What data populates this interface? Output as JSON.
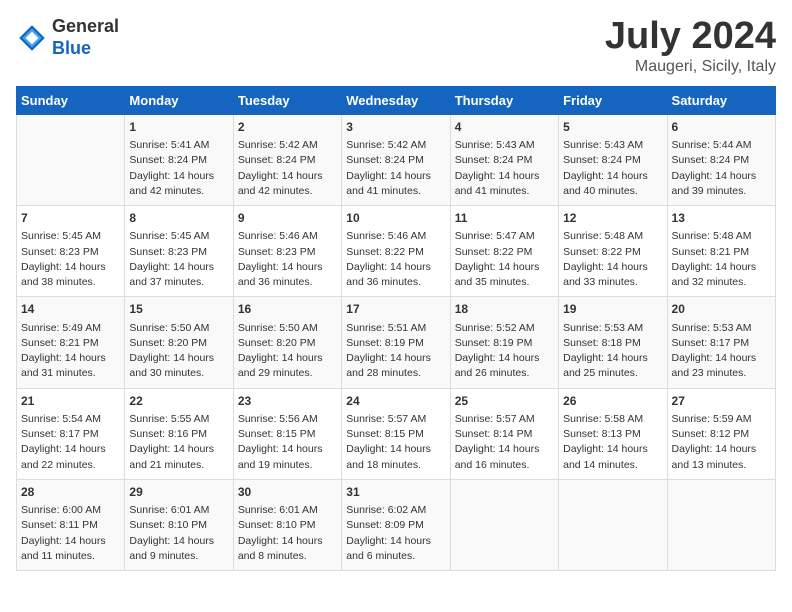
{
  "header": {
    "logo_general": "General",
    "logo_blue": "Blue",
    "month": "July 2024",
    "location": "Maugeri, Sicily, Italy"
  },
  "weekdays": [
    "Sunday",
    "Monday",
    "Tuesday",
    "Wednesday",
    "Thursday",
    "Friday",
    "Saturday"
  ],
  "weeks": [
    [
      {
        "day": "",
        "sunrise": "",
        "sunset": "",
        "daylight": "",
        "empty": true
      },
      {
        "day": "1",
        "sunrise": "Sunrise: 5:41 AM",
        "sunset": "Sunset: 8:24 PM",
        "daylight": "Daylight: 14 hours and 42 minutes."
      },
      {
        "day": "2",
        "sunrise": "Sunrise: 5:42 AM",
        "sunset": "Sunset: 8:24 PM",
        "daylight": "Daylight: 14 hours and 42 minutes."
      },
      {
        "day": "3",
        "sunrise": "Sunrise: 5:42 AM",
        "sunset": "Sunset: 8:24 PM",
        "daylight": "Daylight: 14 hours and 41 minutes."
      },
      {
        "day": "4",
        "sunrise": "Sunrise: 5:43 AM",
        "sunset": "Sunset: 8:24 PM",
        "daylight": "Daylight: 14 hours and 41 minutes."
      },
      {
        "day": "5",
        "sunrise": "Sunrise: 5:43 AM",
        "sunset": "Sunset: 8:24 PM",
        "daylight": "Daylight: 14 hours and 40 minutes."
      },
      {
        "day": "6",
        "sunrise": "Sunrise: 5:44 AM",
        "sunset": "Sunset: 8:24 PM",
        "daylight": "Daylight: 14 hours and 39 minutes."
      }
    ],
    [
      {
        "day": "7",
        "sunrise": "Sunrise: 5:45 AM",
        "sunset": "Sunset: 8:23 PM",
        "daylight": "Daylight: 14 hours and 38 minutes."
      },
      {
        "day": "8",
        "sunrise": "Sunrise: 5:45 AM",
        "sunset": "Sunset: 8:23 PM",
        "daylight": "Daylight: 14 hours and 37 minutes."
      },
      {
        "day": "9",
        "sunrise": "Sunrise: 5:46 AM",
        "sunset": "Sunset: 8:23 PM",
        "daylight": "Daylight: 14 hours and 36 minutes."
      },
      {
        "day": "10",
        "sunrise": "Sunrise: 5:46 AM",
        "sunset": "Sunset: 8:22 PM",
        "daylight": "Daylight: 14 hours and 36 minutes."
      },
      {
        "day": "11",
        "sunrise": "Sunrise: 5:47 AM",
        "sunset": "Sunset: 8:22 PM",
        "daylight": "Daylight: 14 hours and 35 minutes."
      },
      {
        "day": "12",
        "sunrise": "Sunrise: 5:48 AM",
        "sunset": "Sunset: 8:22 PM",
        "daylight": "Daylight: 14 hours and 33 minutes."
      },
      {
        "day": "13",
        "sunrise": "Sunrise: 5:48 AM",
        "sunset": "Sunset: 8:21 PM",
        "daylight": "Daylight: 14 hours and 32 minutes."
      }
    ],
    [
      {
        "day": "14",
        "sunrise": "Sunrise: 5:49 AM",
        "sunset": "Sunset: 8:21 PM",
        "daylight": "Daylight: 14 hours and 31 minutes."
      },
      {
        "day": "15",
        "sunrise": "Sunrise: 5:50 AM",
        "sunset": "Sunset: 8:20 PM",
        "daylight": "Daylight: 14 hours and 30 minutes."
      },
      {
        "day": "16",
        "sunrise": "Sunrise: 5:50 AM",
        "sunset": "Sunset: 8:20 PM",
        "daylight": "Daylight: 14 hours and 29 minutes."
      },
      {
        "day": "17",
        "sunrise": "Sunrise: 5:51 AM",
        "sunset": "Sunset: 8:19 PM",
        "daylight": "Daylight: 14 hours and 28 minutes."
      },
      {
        "day": "18",
        "sunrise": "Sunrise: 5:52 AM",
        "sunset": "Sunset: 8:19 PM",
        "daylight": "Daylight: 14 hours and 26 minutes."
      },
      {
        "day": "19",
        "sunrise": "Sunrise: 5:53 AM",
        "sunset": "Sunset: 8:18 PM",
        "daylight": "Daylight: 14 hours and 25 minutes."
      },
      {
        "day": "20",
        "sunrise": "Sunrise: 5:53 AM",
        "sunset": "Sunset: 8:17 PM",
        "daylight": "Daylight: 14 hours and 23 minutes."
      }
    ],
    [
      {
        "day": "21",
        "sunrise": "Sunrise: 5:54 AM",
        "sunset": "Sunset: 8:17 PM",
        "daylight": "Daylight: 14 hours and 22 minutes."
      },
      {
        "day": "22",
        "sunrise": "Sunrise: 5:55 AM",
        "sunset": "Sunset: 8:16 PM",
        "daylight": "Daylight: 14 hours and 21 minutes."
      },
      {
        "day": "23",
        "sunrise": "Sunrise: 5:56 AM",
        "sunset": "Sunset: 8:15 PM",
        "daylight": "Daylight: 14 hours and 19 minutes."
      },
      {
        "day": "24",
        "sunrise": "Sunrise: 5:57 AM",
        "sunset": "Sunset: 8:15 PM",
        "daylight": "Daylight: 14 hours and 18 minutes."
      },
      {
        "day": "25",
        "sunrise": "Sunrise: 5:57 AM",
        "sunset": "Sunset: 8:14 PM",
        "daylight": "Daylight: 14 hours and 16 minutes."
      },
      {
        "day": "26",
        "sunrise": "Sunrise: 5:58 AM",
        "sunset": "Sunset: 8:13 PM",
        "daylight": "Daylight: 14 hours and 14 minutes."
      },
      {
        "day": "27",
        "sunrise": "Sunrise: 5:59 AM",
        "sunset": "Sunset: 8:12 PM",
        "daylight": "Daylight: 14 hours and 13 minutes."
      }
    ],
    [
      {
        "day": "28",
        "sunrise": "Sunrise: 6:00 AM",
        "sunset": "Sunset: 8:11 PM",
        "daylight": "Daylight: 14 hours and 11 minutes."
      },
      {
        "day": "29",
        "sunrise": "Sunrise: 6:01 AM",
        "sunset": "Sunset: 8:10 PM",
        "daylight": "Daylight: 14 hours and 9 minutes."
      },
      {
        "day": "30",
        "sunrise": "Sunrise: 6:01 AM",
        "sunset": "Sunset: 8:10 PM",
        "daylight": "Daylight: 14 hours and 8 minutes."
      },
      {
        "day": "31",
        "sunrise": "Sunrise: 6:02 AM",
        "sunset": "Sunset: 8:09 PM",
        "daylight": "Daylight: 14 hours and 6 minutes."
      },
      {
        "day": "",
        "sunrise": "",
        "sunset": "",
        "daylight": "",
        "empty": true
      },
      {
        "day": "",
        "sunrise": "",
        "sunset": "",
        "daylight": "",
        "empty": true
      },
      {
        "day": "",
        "sunrise": "",
        "sunset": "",
        "daylight": "",
        "empty": true
      }
    ]
  ]
}
